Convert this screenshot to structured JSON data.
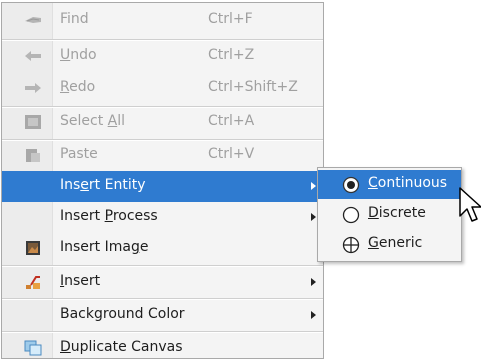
{
  "menu": {
    "items": [
      {
        "label": "Find",
        "shortcut": "Ctrl+F",
        "icon": "find-icon",
        "state": "disabled"
      },
      {
        "label": "Undo",
        "mnemonic": "U",
        "shortcut": "Ctrl+Z",
        "icon": "undo-icon",
        "state": "disabled"
      },
      {
        "label": "Redo",
        "mnemonic": "R",
        "shortcut": "Ctrl+Shift+Z",
        "icon": "redo-icon",
        "state": "disabled"
      },
      {
        "label": "Select All",
        "mnemonic": "A",
        "shortcut": "Ctrl+A",
        "icon": "select-all-icon",
        "state": "disabled"
      },
      {
        "label": "Paste",
        "shortcut": "Ctrl+V",
        "icon": "paste-icon",
        "state": "disabled"
      },
      {
        "label": "Insert Entity",
        "mnemonic": "E",
        "submenu": true,
        "state": "highlighted"
      },
      {
        "label": "Insert Process",
        "mnemonic": "P",
        "submenu": true,
        "state": "enabled"
      },
      {
        "label": "Insert Image",
        "mnemonic": "g",
        "icon": "image-icon",
        "state": "enabled"
      },
      {
        "label": "Insert",
        "mnemonic": "I",
        "icon": "insert-icon",
        "submenu": true,
        "state": "enabled"
      },
      {
        "label": "Background Color",
        "submenu": true,
        "state": "enabled"
      },
      {
        "label": "Duplicate Canvas",
        "mnemonic": "D",
        "icon": "duplicate-canvas-icon",
        "state": "enabled"
      }
    ]
  },
  "submenu": {
    "items": [
      {
        "label": "Continuous",
        "mnemonic": "C",
        "icon": "radio-selected-icon",
        "state": "highlighted"
      },
      {
        "label": "Discrete",
        "mnemonic": "D",
        "icon": "radio-empty-icon",
        "state": "enabled"
      },
      {
        "label": "Generic",
        "mnemonic": "G",
        "icon": "crosshair-circle-icon",
        "state": "enabled"
      }
    ]
  },
  "colors": {
    "highlight": "#2f7bd0",
    "menu_background": "#f4f4f4",
    "disabled_text": "#a0a0a0"
  }
}
